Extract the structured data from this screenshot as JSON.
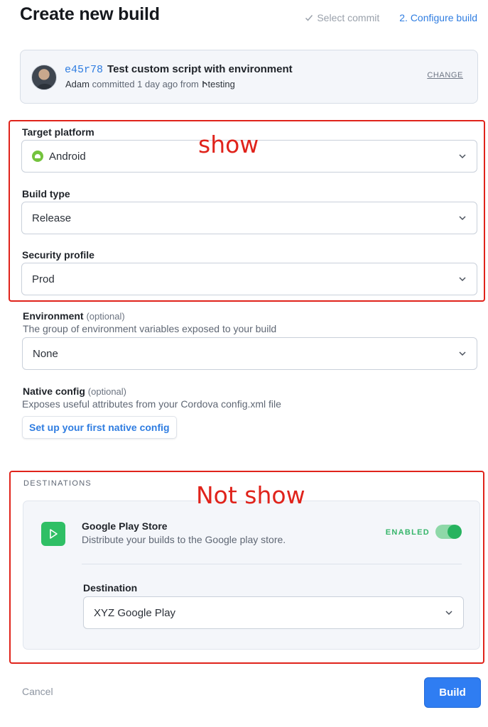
{
  "header": {
    "title": "Create new build",
    "steps": [
      {
        "label": "Select commit",
        "state": "done"
      },
      {
        "label": "2. Configure build",
        "state": "active"
      }
    ]
  },
  "commit": {
    "hash": "e45r78",
    "message": "Test custom script with environment",
    "author": "Adam",
    "meta_text": "committed 1 day ago from",
    "branch": "testing",
    "change_label": "CHANGE"
  },
  "form": {
    "target_platform": {
      "label": "Target platform",
      "value": "Android"
    },
    "build_type": {
      "label": "Build type",
      "value": "Release"
    },
    "security_profile": {
      "label": "Security profile",
      "value": "Prod"
    },
    "environment": {
      "label": "Environment",
      "optional": "(optional)",
      "help": "The group of environment variables exposed to your build",
      "value": "None"
    },
    "native_config": {
      "label": "Native config",
      "optional": "(optional)",
      "help": "Exposes useful attributes from your Cordova config.xml file",
      "button": "Set up your first native config"
    }
  },
  "destinations": {
    "heading": "DESTINATIONS",
    "store_name": "Google Play Store",
    "store_desc": "Distribute your builds to the Google play store.",
    "status": "ENABLED",
    "enabled": true,
    "destination_label": "Destination",
    "destination_value": "XYZ Google Play"
  },
  "annotations": {
    "show": "show",
    "not_show": "Not show"
  },
  "footer": {
    "cancel": "Cancel",
    "build": "Build"
  },
  "colors": {
    "accent": "#2f7de1",
    "annotation": "#e0231b",
    "enabled": "#27b35f"
  }
}
